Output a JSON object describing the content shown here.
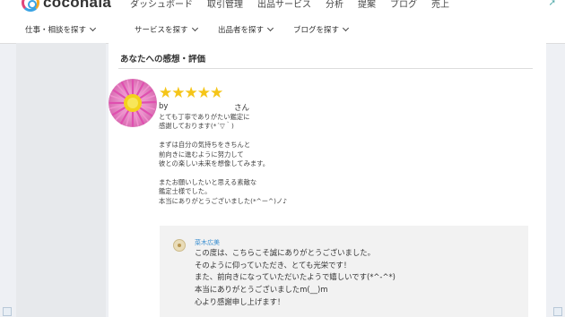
{
  "app": {
    "logo_text": "coconala"
  },
  "top_nav": {
    "items": [
      "ダッシュボード",
      "取引管理",
      "出品サービス",
      "分析",
      "提案",
      "ブログ",
      "売上"
    ]
  },
  "category_nav": {
    "items": [
      "仕事・相談を探す",
      "サービスを探す",
      "出品者を探す",
      "ブログを探す"
    ]
  },
  "review_section": {
    "title": "あなたへの感想・評価",
    "rating": 5,
    "stars": "★★★★★",
    "by_label": "by",
    "san_label": "さん",
    "text": "とても丁寧でありがたい鑑定に\n感謝しております(*´▽｀)\n\nまずは自分の気持ちをきちんと\n前向きに進むように努力して\n彼との楽しい未来を想像してみます。\n\nまたお願いしたいと思える素敵な\n鑑定士様でした。\n本当にありがとうございました(*^ー^)ノ♪"
  },
  "reply": {
    "name": "菜木広美",
    "text": "この度は、こちらこそ誠にありがとうございました。\nそのように仰っていただき、とても光栄です！\nまた、前向きになっていただいたようで嬉しいです(*^-^*)\n本当にありがとうございましたm(__)m\n心より感謝申し上げます！"
  },
  "colors": {
    "star": "#f5c518",
    "reply_name": "#3a8fd0",
    "panel_bg": "#f2f2f2"
  }
}
